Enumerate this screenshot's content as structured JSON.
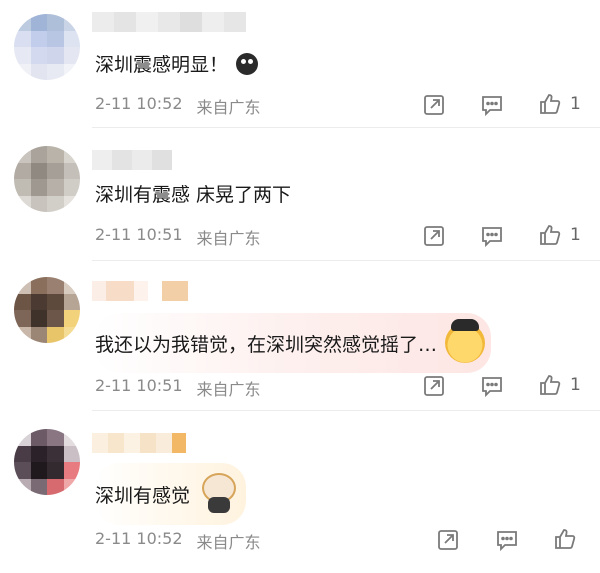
{
  "comments": [
    {
      "text": "深圳震感明显！",
      "time": "2-11 10:52",
      "location": "来自广东",
      "likes": "1"
    },
    {
      "text": "深圳有震感 床晃了两下",
      "time": "2-11 10:51",
      "location": "来自广东",
      "likes": "1"
    },
    {
      "text": "我还以为我错觉，在深圳突然感觉摇了…",
      "time": "2-11 10:51",
      "location": "来自广东",
      "likes": "1"
    },
    {
      "text": "深圳有感觉",
      "time": "2-11 10:52",
      "location": "来自广东",
      "likes": ""
    }
  ],
  "icons": {
    "share": "share-icon",
    "reply": "comment-icon",
    "like": "thumbs-up-icon"
  },
  "colors": {
    "meta_text": "#8a8a8a",
    "icon": "#7a7a7a",
    "bubble_pink": "#fde8e6",
    "bubble_yellow": "#fff6e3"
  }
}
